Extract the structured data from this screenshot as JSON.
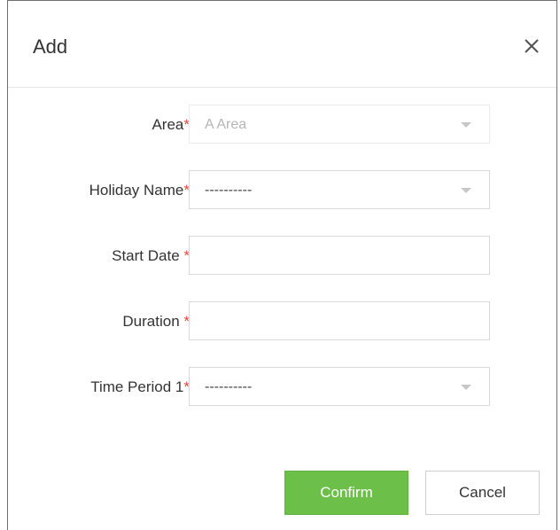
{
  "dialog": {
    "title": "Add",
    "close_glyph": "×"
  },
  "form": {
    "area": {
      "label": "Area",
      "required": "*",
      "value": "A Area",
      "disabled": true
    },
    "holiday_name": {
      "label": "Holiday Name",
      "required": "*",
      "value": "----------"
    },
    "start_date": {
      "label": "Start Date ",
      "required": "*",
      "value": ""
    },
    "duration": {
      "label": "Duration ",
      "required": "*",
      "value": ""
    },
    "time_period_1": {
      "label": "Time Period 1",
      "required": "*",
      "value": "----------"
    }
  },
  "buttons": {
    "confirm": "Confirm",
    "cancel": "Cancel"
  },
  "colors": {
    "confirm_bg": "#6cc04a",
    "required_star": "#e5483f"
  },
  "icons": {
    "close": "close-icon",
    "dropdown": "chevron-down-icon"
  }
}
